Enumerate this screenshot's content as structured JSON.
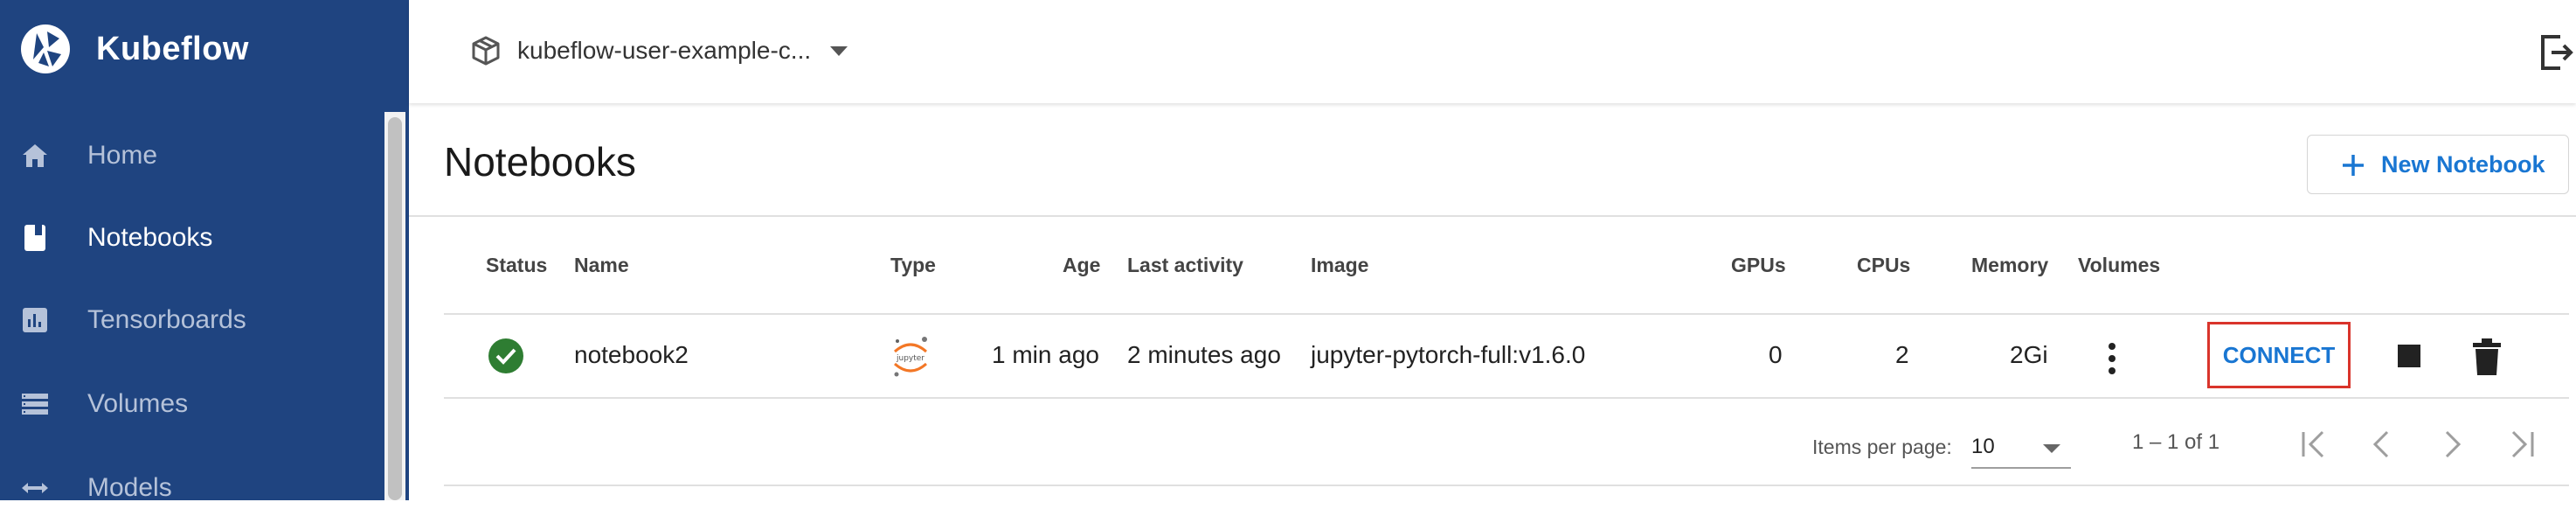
{
  "app": {
    "name": "Kubeflow"
  },
  "sidebar": {
    "items": [
      {
        "label": "Home",
        "icon": "home-icon",
        "active": false
      },
      {
        "label": "Notebooks",
        "icon": "notebook-icon",
        "active": true
      },
      {
        "label": "Tensorboards",
        "icon": "chart-icon",
        "active": false
      },
      {
        "label": "Volumes",
        "icon": "storage-icon",
        "active": false
      },
      {
        "label": "Models",
        "icon": "arrows-icon",
        "active": false
      }
    ]
  },
  "topbar": {
    "namespace": "kubeflow-user-example-c...",
    "namespace_icon": "cube-icon",
    "logout_icon": "logout-icon"
  },
  "page": {
    "title": "Notebooks",
    "new_button_label": "New Notebook"
  },
  "table": {
    "headers": {
      "status": "Status",
      "name": "Name",
      "type": "Type",
      "age": "Age",
      "last_activity": "Last activity",
      "image": "Image",
      "gpus": "GPUs",
      "cpus": "CPUs",
      "memory": "Memory",
      "volumes": "Volumes"
    },
    "rows": [
      {
        "status": "ready",
        "name": "notebook2",
        "type": "jupyter",
        "age": "1 min ago",
        "last_activity": "2 minutes ago",
        "image": "jupyter-pytorch-full:v1.6.0",
        "gpus": "0",
        "cpus": "2",
        "memory": "2Gi",
        "connect_label": "CONNECT"
      }
    ]
  },
  "paginator": {
    "items_per_page_label": "Items per page:",
    "items_per_page_value": "10",
    "range_label": "1 – 1 of 1"
  },
  "colors": {
    "sidebar_bg": "#1f4480",
    "accent": "#1976d2",
    "status_ok": "#2e7d32",
    "highlight": "#d9342b"
  }
}
